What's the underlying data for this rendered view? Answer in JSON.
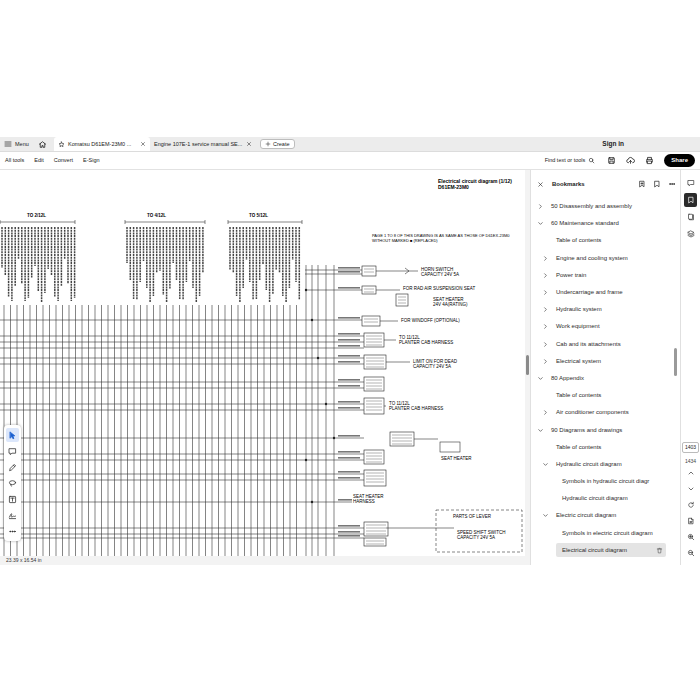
{
  "tab_bar": {
    "menu": "Menu",
    "tabs": [
      {
        "label": "Komatsu D61EM-23M0 ...",
        "selected": true
      },
      {
        "label": "Engine 107E-1 service manual SE...",
        "selected": false
      }
    ],
    "create": "Create",
    "sign_in": "Sign in"
  },
  "toolbar": {
    "items": [
      "All tools",
      "Edit",
      "Convert",
      "E-Sign"
    ],
    "search": "Find text or tools",
    "share": "Share"
  },
  "document": {
    "title": "Electrical circuit diagram (1/12)",
    "model": "D61EM-23M0",
    "note": [
      "PAGE 1 TO 8 OF THIS DRAWING IS AS SAME AS THOSE OF D61EX-23M0",
      "WITHOUT MARKED ■ (REPLACED)"
    ],
    "bundle_headers": [
      "TO 2/12L",
      "TO 4/12L",
      "TO 5/12L"
    ],
    "labels": [
      {
        "lines": [
          "HORN SWITCH",
          "CAPACITY 24V 5A"
        ]
      },
      {
        "lines": [
          "FOR RAD AIR SUSPENSION SEAT"
        ]
      },
      {
        "lines": [
          "SEAT HEATER",
          "24V 4A(RATING)"
        ]
      },
      {
        "lines": [
          "FOR WINDOFF (OPTIONAL)"
        ]
      },
      {
        "lines": [
          "TO 11/12L",
          "PLANTER CAB HARNESS"
        ]
      },
      {
        "lines": [
          "LIMIT ON FOR DEAD",
          "CAPACITY 24V 5A"
        ]
      },
      {
        "lines": [
          "TO 11/12L",
          "PLANTER CAB HARNESS"
        ]
      },
      {
        "lines": [
          "SEAT HEATER"
        ]
      },
      {
        "lines": [
          "SEAT HEATER",
          "HARNESS"
        ]
      },
      {
        "lines": [
          "PARTS OF LEVER"
        ]
      },
      {
        "lines": [
          "SPEED SHIFT SWITCH",
          "CAPACITY 24V 5A"
        ]
      }
    ]
  },
  "tools": [
    {
      "selected": true
    },
    {
      "selected": false
    },
    {
      "selected": false
    },
    {
      "selected": false
    },
    {
      "selected": false
    },
    {
      "selected": false
    },
    {
      "selected": false
    }
  ],
  "bookmarks": {
    "title": "Bookmarks",
    "items": [
      {
        "label": "50 Disassembly and assembly",
        "kind": "group",
        "expanded": false,
        "selected": false
      },
      {
        "label": "60 Maintenance standard",
        "kind": "group",
        "expanded": true,
        "selected": false,
        "children": [
          {
            "label": "Table of contents",
            "kind": "leaf",
            "selected": false
          },
          {
            "label": "Engine and cooling system",
            "kind": "group",
            "expanded": false,
            "selected": false
          },
          {
            "label": "Power train",
            "kind": "group",
            "expanded": false,
            "selected": false
          },
          {
            "label": "Undercarriage and frame",
            "kind": "group",
            "expanded": false,
            "selected": false
          },
          {
            "label": "Hydraulic system",
            "kind": "group",
            "expanded": false,
            "selected": false
          },
          {
            "label": "Work equipment",
            "kind": "group",
            "expanded": false,
            "selected": false
          },
          {
            "label": "Cab and its attachments",
            "kind": "group",
            "expanded": false,
            "selected": false
          },
          {
            "label": "Electrical system",
            "kind": "group",
            "expanded": false,
            "selected": false
          }
        ]
      },
      {
        "label": "80 Appendix",
        "kind": "group",
        "expanded": true,
        "selected": false,
        "children": [
          {
            "label": "Table of contents",
            "kind": "leaf",
            "selected": false
          },
          {
            "label": "Air conditioner components",
            "kind": "group",
            "expanded": false,
            "selected": false
          }
        ]
      },
      {
        "label": "90 Diagrams and drawings",
        "kind": "group",
        "expanded": true,
        "selected": false,
        "children": [
          {
            "label": "Table of contents",
            "kind": "leaf",
            "selected": false
          },
          {
            "label": "Hydraulic circuit diagram",
            "kind": "group",
            "expanded": true,
            "selected": false,
            "children": [
              {
                "label": "Symbols in hydraulic circuit diagr",
                "kind": "leaf",
                "selected": false
              },
              {
                "label": "Hydraulic circuit diagram",
                "kind": "leaf",
                "selected": false
              }
            ]
          },
          {
            "label": "Electric circuit diagram",
            "kind": "group",
            "expanded": true,
            "selected": false,
            "children": [
              {
                "label": "Symbols in electric circuit diagram",
                "kind": "leaf",
                "selected": false
              },
              {
                "label": "Electrical circuit diagram",
                "kind": "leaf",
                "selected": true
              }
            ]
          }
        ]
      }
    ]
  },
  "page_nav": {
    "current": "1403",
    "total": "1434"
  },
  "status_bar": {
    "size": "23.39 x 16.54 in"
  }
}
